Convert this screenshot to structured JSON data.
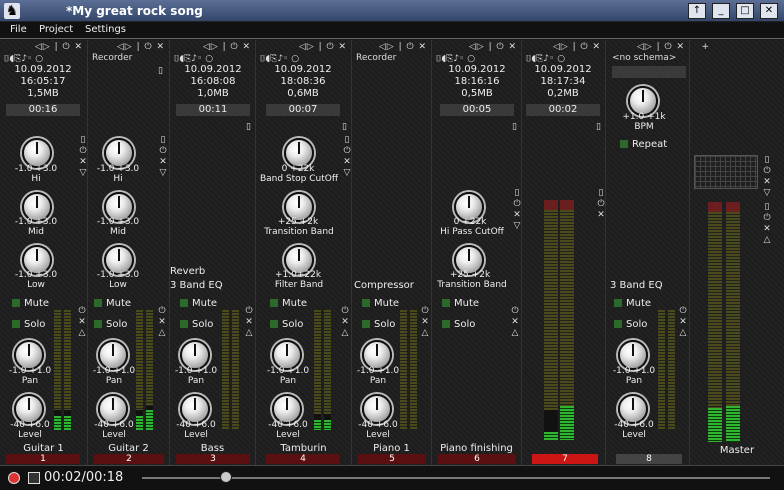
{
  "window": {
    "title": "*My great rock song"
  },
  "menu": [
    "File",
    "Project",
    "Settings"
  ],
  "strip1": {
    "date": "10.09.2012",
    "time": "16:05:17",
    "size": "1,5MB",
    "dur": "00:16",
    "name": "Guitar 1",
    "num": "1"
  },
  "strip2": {
    "sub": "Recorder",
    "name": "Guitar 2",
    "num": "2"
  },
  "strip3": {
    "date": "10.09.2012",
    "time": "16:08:08",
    "size": "1,0MB",
    "dur": "00:11",
    "fx1": "Reverb",
    "fx2": "3 Band EQ",
    "name": "Bass",
    "num": "3"
  },
  "strip4": {
    "date": "10.09.2012",
    "time": "18:08:36",
    "size": "0,6MB",
    "dur": "00:07",
    "name": "Tamburin",
    "num": "4",
    "k1": "Band Stop CutOff",
    "k1r": "0    +22k",
    "k2": "Transition Band",
    "k2r": "+25  +2k",
    "k3": "Filter Band",
    "k3r": "+1.0+22k"
  },
  "strip5": {
    "sub": "Recorder",
    "fx": "Compressor",
    "name": "Piano 1",
    "num": "5"
  },
  "strip6": {
    "date": "10.09.2012",
    "time": "18:16:16",
    "size": "0,5MB",
    "dur": "00:05",
    "name": "Piano finishing",
    "num": "6",
    "k1": "Hi Pass CutOff",
    "k1r": "0    +22k",
    "k2": "Transition Band",
    "k2r": "+25  +2k"
  },
  "strip7": {
    "date": "10.09.2012",
    "time": "18:17:34",
    "size": "0,2MB",
    "dur": "00:02",
    "num": "7"
  },
  "strip8": {
    "sub": "<no schema>",
    "bpm": "BPM",
    "bpmr": "+1.0  +1k",
    "repeat": "Repeat",
    "fx": "3 Band EQ",
    "num": "8"
  },
  "master": {
    "name": "Master"
  },
  "eq": {
    "hi": "Hi",
    "mid": "Mid",
    "low": "Low",
    "range": "-1.0 +3.0"
  },
  "ctl": {
    "mute": "Mute",
    "solo": "Solo",
    "pan": "Pan",
    "panr": "-1.0 +1.0",
    "level": "Level",
    "levelr": "-40 +6.0",
    "zero": "0"
  },
  "transport": {
    "time": "00:02/00:18"
  }
}
